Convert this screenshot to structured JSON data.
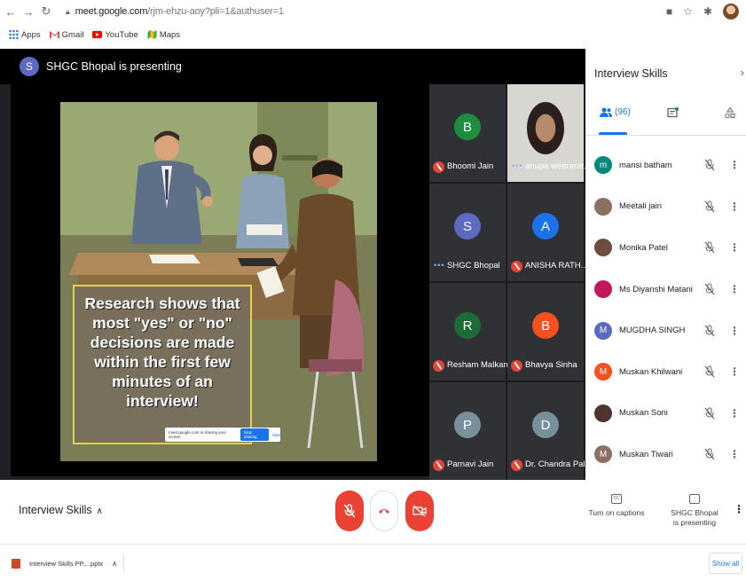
{
  "browser": {
    "url_host": "meet.google.com",
    "url_path": "/rjm-ehzu-aoy?pli=1&authuser=1",
    "bookmarks": [
      {
        "label": "Apps",
        "icon": "apps-grid-icon",
        "color": "#1a73e8"
      },
      {
        "label": "Gmail",
        "icon": "gmail-icon",
        "color": "#ea4335"
      },
      {
        "label": "YouTube",
        "icon": "youtube-icon",
        "color": "#ff0000"
      },
      {
        "label": "Maps",
        "icon": "maps-icon",
        "color": "#34a853"
      }
    ]
  },
  "presenter": {
    "avatar_letter": "S",
    "text": "SHGC Bhopal is presenting"
  },
  "slide": {
    "caption_lines": [
      "Research shows that",
      "most \"yes\" or \"no\"",
      "decisions are made",
      "within the first few",
      "minutes of an interview!"
    ],
    "share_text": "meet.google.com is sharing your screen.",
    "share_stop": "Stop sharing",
    "share_hide": "Hide"
  },
  "tiles": [
    {
      "name": "Bhoomi Jain",
      "letter": "B",
      "color": "#1e8e3e",
      "muted": true
    },
    {
      "name": "anupa weerarat...",
      "letter": "",
      "color": "#303134",
      "muted": false,
      "video": true
    },
    {
      "name": "SHGC Bhopal",
      "letter": "S",
      "color": "#5c6bc0",
      "muted": false
    },
    {
      "name": "ANISHA RATH...",
      "letter": "A",
      "color": "#1a73e8",
      "muted": true
    },
    {
      "name": "Resham Malkani",
      "letter": "R",
      "color": "#1e6b3a",
      "muted": true
    },
    {
      "name": "Bhavya Sinha",
      "letter": "B",
      "color": "#f4511e",
      "muted": true
    },
    {
      "name": "Parnavi Jain",
      "letter": "P",
      "color": "#78909c",
      "muted": true
    },
    {
      "name": "Dr. Chandra Pal...",
      "letter": "D",
      "color": "#78909c",
      "muted": true
    }
  ],
  "panel": {
    "title": "Interview Skills",
    "people_count": "(96)",
    "participants": [
      {
        "name": "mansi batham",
        "letter": "m",
        "color": "#00897b"
      },
      {
        "name": "Meetali jain",
        "letter": "",
        "color": "#8d6e63"
      },
      {
        "name": "Monika Patel",
        "letter": "",
        "color": "#6d4c41"
      },
      {
        "name": "Ms Diyanshi Matani",
        "letter": "",
        "color": "#c2185b"
      },
      {
        "name": "MUGDHA SINGH",
        "letter": "M",
        "color": "#5c6bc0"
      },
      {
        "name": "Muskan Khilwani",
        "letter": "M",
        "color": "#f4511e"
      },
      {
        "name": "Muskan Soni",
        "letter": "",
        "color": "#4e342e"
      },
      {
        "name": "Muskan Tiwari",
        "letter": "M",
        "color": "#8d6e63"
      }
    ]
  },
  "controls": {
    "meeting_name": "Interview Skills",
    "captions_label": "Turn on captions",
    "presenting_line1": "SHGC Bhopal",
    "presenting_line2": "is presenting"
  },
  "download": {
    "file": "Interview Skills PP....pptx",
    "show_all": "Show all"
  }
}
